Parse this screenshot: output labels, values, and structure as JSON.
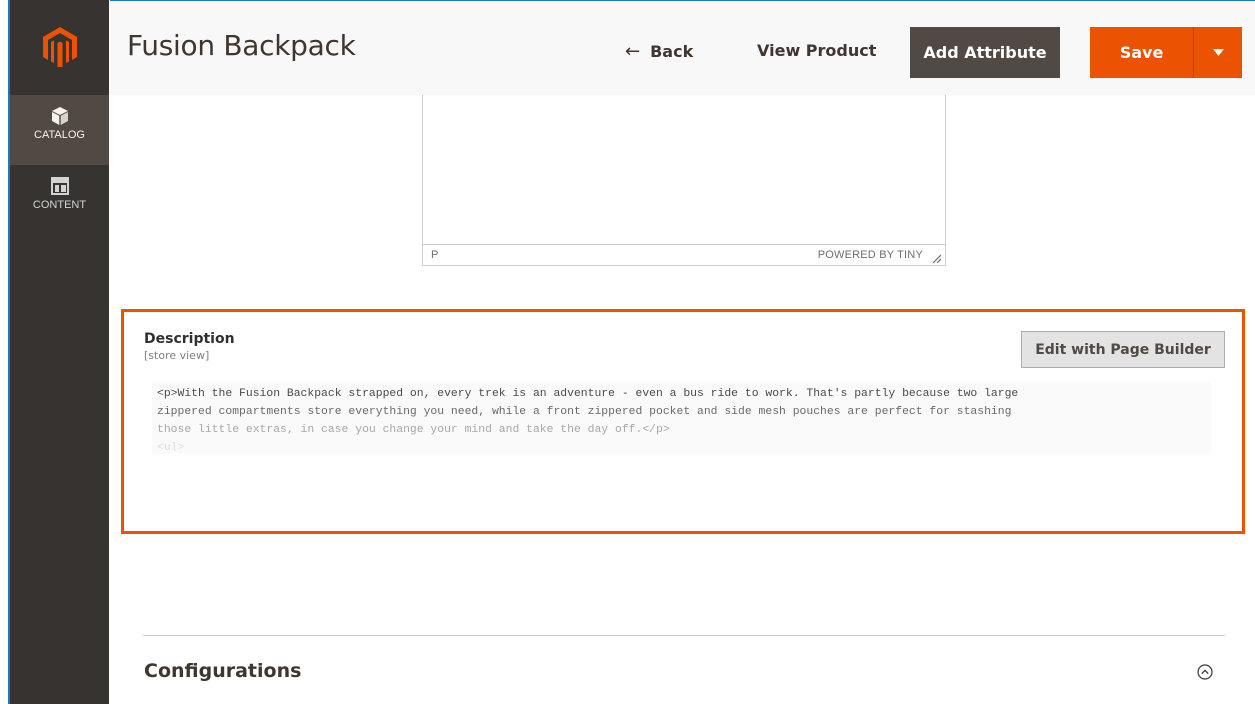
{
  "app": {
    "brand_color": "#eb5202",
    "sidebar_bg": "#373330",
    "logo": "magento-logo-icon"
  },
  "sidebar": {
    "items": [
      {
        "label": "CATALOG",
        "icon": "box-icon",
        "active": true
      },
      {
        "label": "CONTENT",
        "icon": "layout-icon",
        "active": false
      }
    ]
  },
  "header": {
    "title": "Fusion Backpack",
    "back_arrow": "←",
    "back_label": "Back",
    "view_product_label": "View Product",
    "add_attribute_label": "Add Attribute",
    "save_label": "Save"
  },
  "editor": {
    "status_path": "P",
    "powered_by": "POWERED BY TINY"
  },
  "description": {
    "label": "Description",
    "scope": "[store view]",
    "page_builder_label": "Edit with Page Builder",
    "content_lines": [
      "<p>With the Fusion Backpack strapped on, every trek is an adventure - even a bus ride to work. That's partly because two large",
      "zippered compartments store everything you need, while a front zippered pocket and side mesh pouches are perfect for stashing",
      "those little extras, in case you change your mind and take the day off.</p>",
      "<ul>"
    ]
  },
  "configurations": {
    "title": "Configurations"
  }
}
